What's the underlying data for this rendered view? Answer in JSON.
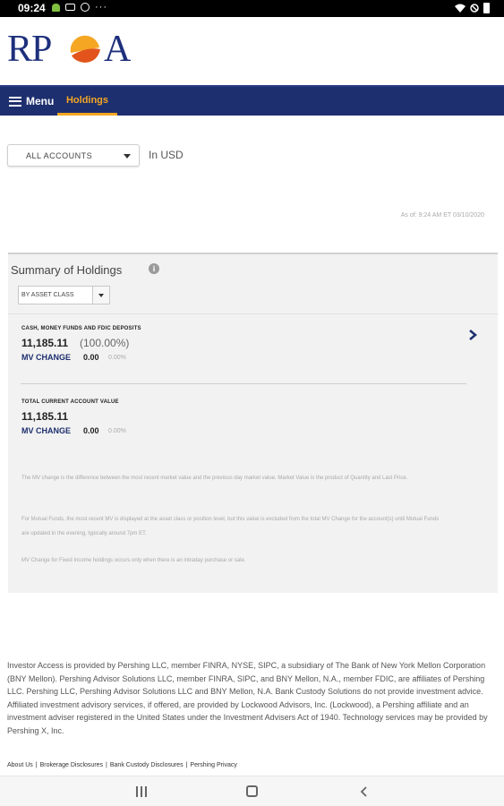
{
  "status_bar": {
    "time": "09:24",
    "left_icons": [
      "android-icon",
      "notification-box-icon",
      "circle-icon",
      "more-dots-icon"
    ],
    "right_icons": [
      "wifi-icon",
      "do-not-disturb-icon",
      "battery-icon"
    ],
    "dots": "···"
  },
  "header": {
    "logo_text_left": "RP",
    "logo_text_right": "A",
    "logo_colors": {
      "navy": "#1d2f7c",
      "orange": "#f5a623",
      "red": "#e2541b"
    }
  },
  "nav": {
    "menu_label": "Menu",
    "tabs": [
      {
        "label": "Holdings",
        "active": true
      }
    ],
    "bar_color": "#1d2f6e",
    "accent_color": "#f5a623"
  },
  "account": {
    "selected": "ALL ACCOUNTS",
    "currency_label": "In USD"
  },
  "as_of": "As of: 9:24 AM ET 03/10/2020",
  "summary": {
    "title": "Summary of Holdings",
    "group_by": "BY ASSET CLASS",
    "rows": [
      {
        "label": "CASH, MONEY FUNDS AND FDIC DEPOSITS",
        "value": "11,185.11",
        "percent": "(100.00%)",
        "mv_change_label": "MV CHANGE",
        "mv_change_value": "0.00",
        "mv_change_pct": "0.00%"
      },
      {
        "label": "TOTAL CURRENT ACCOUNT VALUE",
        "value": "11,185.11",
        "mv_change_label": "MV CHANGE",
        "mv_change_value": "0.00",
        "mv_change_pct": "0.00%"
      }
    ],
    "notes": [
      "The MV change is the difference between the most recent market value and the previous day market value. Market Value is the product of Quantity and Last Price.",
      "For Mutual Funds, the most recent MV is displayed at the asset class or position level, but this value is excluded from the total MV Change for the account(s) until Mutual Funds are updated in the evening, typically around 7pm ET.",
      "MV Change for Fixed Income holdings occurs only when there is an intraday purchase or sale."
    ]
  },
  "footer": {
    "disclaimer": "Investor Access is provided by Pershing LLC, member FINRA, NYSE, SIPC, a subsidiary of The Bank of New York Mellon Corporation (BNY Mellon). Pershing Advisor Solutions LLC, member FINRA, SIPC, and BNY Mellon, N.A., member FDIC, are affiliates of Pershing LLC. Pershing LLC, Pershing Advisor Solutions LLC and BNY Mellon, N.A. Bank Custody Solutions do not provide investment advice. Affiliated investment advisory services, if offered, are provided by Lockwood Advisors, Inc. (Lockwood), a Pershing affiliate and an investment adviser registered in the United States under the Investment Advisers Act of 1940. Technology services may be provided by Pershing X, Inc.",
    "links": [
      "About Us",
      "Brokerage Disclosures",
      "Bank Custody Disclosures",
      "Pershing Privacy"
    ],
    "separator": "|"
  },
  "system_nav": {
    "buttons": [
      "recents-icon",
      "home-icon",
      "back-icon"
    ]
  }
}
